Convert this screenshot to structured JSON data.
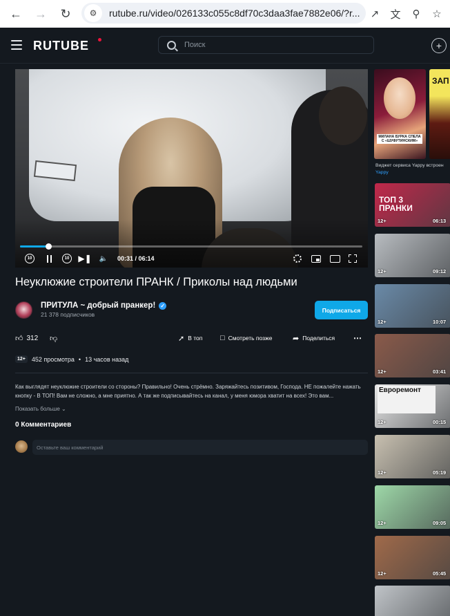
{
  "browser": {
    "url": "rutube.ru/video/026133c055c8df70c3daa3fae7882e06/?r...",
    "icons": [
      "back-icon",
      "forward-icon",
      "reload-icon",
      "site-info-icon",
      "open-in-app-icon",
      "translate-icon",
      "zoom-icon",
      "bookmark-star-icon"
    ]
  },
  "header": {
    "logo": "RUTUBE",
    "search_placeholder": "Поиск",
    "accent": "#ed143b"
  },
  "player": {
    "current_time": "00:31",
    "duration": "06:14",
    "time_display": "00:31 / 06:14",
    "progress": 0.083,
    "rewind_label": "10",
    "forward_label": "10",
    "accent": "#0fa8e8"
  },
  "video": {
    "title": "Неуклюжие строители ПРАНК / Приколы над людьми",
    "views": "452 просмотра",
    "separator": "•",
    "published": "13 часов назад",
    "age_rating": "12+",
    "description": "Как выглядят неуклюжие строители со стороны? Правильно! Очень стрёмно. Заряжайтесь позитивом, Господа. НЕ пожалейте нажать кнопку - В ТОП! Вам не сложно, а мне приятно. А так же подписывайтесь на канал, у меня юмора хватит на всех! Это вам...",
    "show_more": "Показать больше"
  },
  "channel": {
    "name": "ПРИТУЛА ~ добрый пранкер!",
    "subscribers": "21 378 подписчиков",
    "subscribe_label": "Подписаться"
  },
  "actions": {
    "likes": "312",
    "top_label": "В топ",
    "watch_later_label": "Смотреть позже",
    "share_label": "Поделиться",
    "more_label": "⋯"
  },
  "comments": {
    "title": "0 Комментариев",
    "placeholder": "Оставьте ваш комментарий"
  },
  "sidebar": {
    "promo_caption": "МИЛАНА БУРКА СПЕЛА С «ШУФУТИНСКИМ»",
    "promo_side_text": "ЗАП",
    "widget_note": "Виджет сервиса Yappy встроен",
    "widget_brand": "Yappy",
    "videos": [
      {
        "age": "12+",
        "duration": "06:13",
        "label": "ТОП 3\nПРАНКИ",
        "bg": "#c0284a"
      },
      {
        "age": "12+",
        "duration": "09:12",
        "label": "",
        "bg": "#b8bcc0"
      },
      {
        "age": "12+",
        "duration": "10:07",
        "label": "",
        "bg": "#6a8aa8"
      },
      {
        "age": "12+",
        "duration": "03:41",
        "label": "",
        "bg": "#8a5a4a"
      },
      {
        "age": "12+",
        "duration": "00:15",
        "label": "Евроремонт",
        "bg": "#e8e8e8"
      },
      {
        "age": "12+",
        "duration": "05:19",
        "label": "",
        "bg": "#c8c0b0"
      },
      {
        "age": "12+",
        "duration": "09:05",
        "label": "",
        "bg": "#9ed8a8"
      },
      {
        "age": "12+",
        "duration": "05:45",
        "label": "",
        "bg": "#a06a4a"
      },
      {
        "age": "",
        "duration": "",
        "label": "",
        "bg": "#c0c4c8"
      }
    ]
  }
}
